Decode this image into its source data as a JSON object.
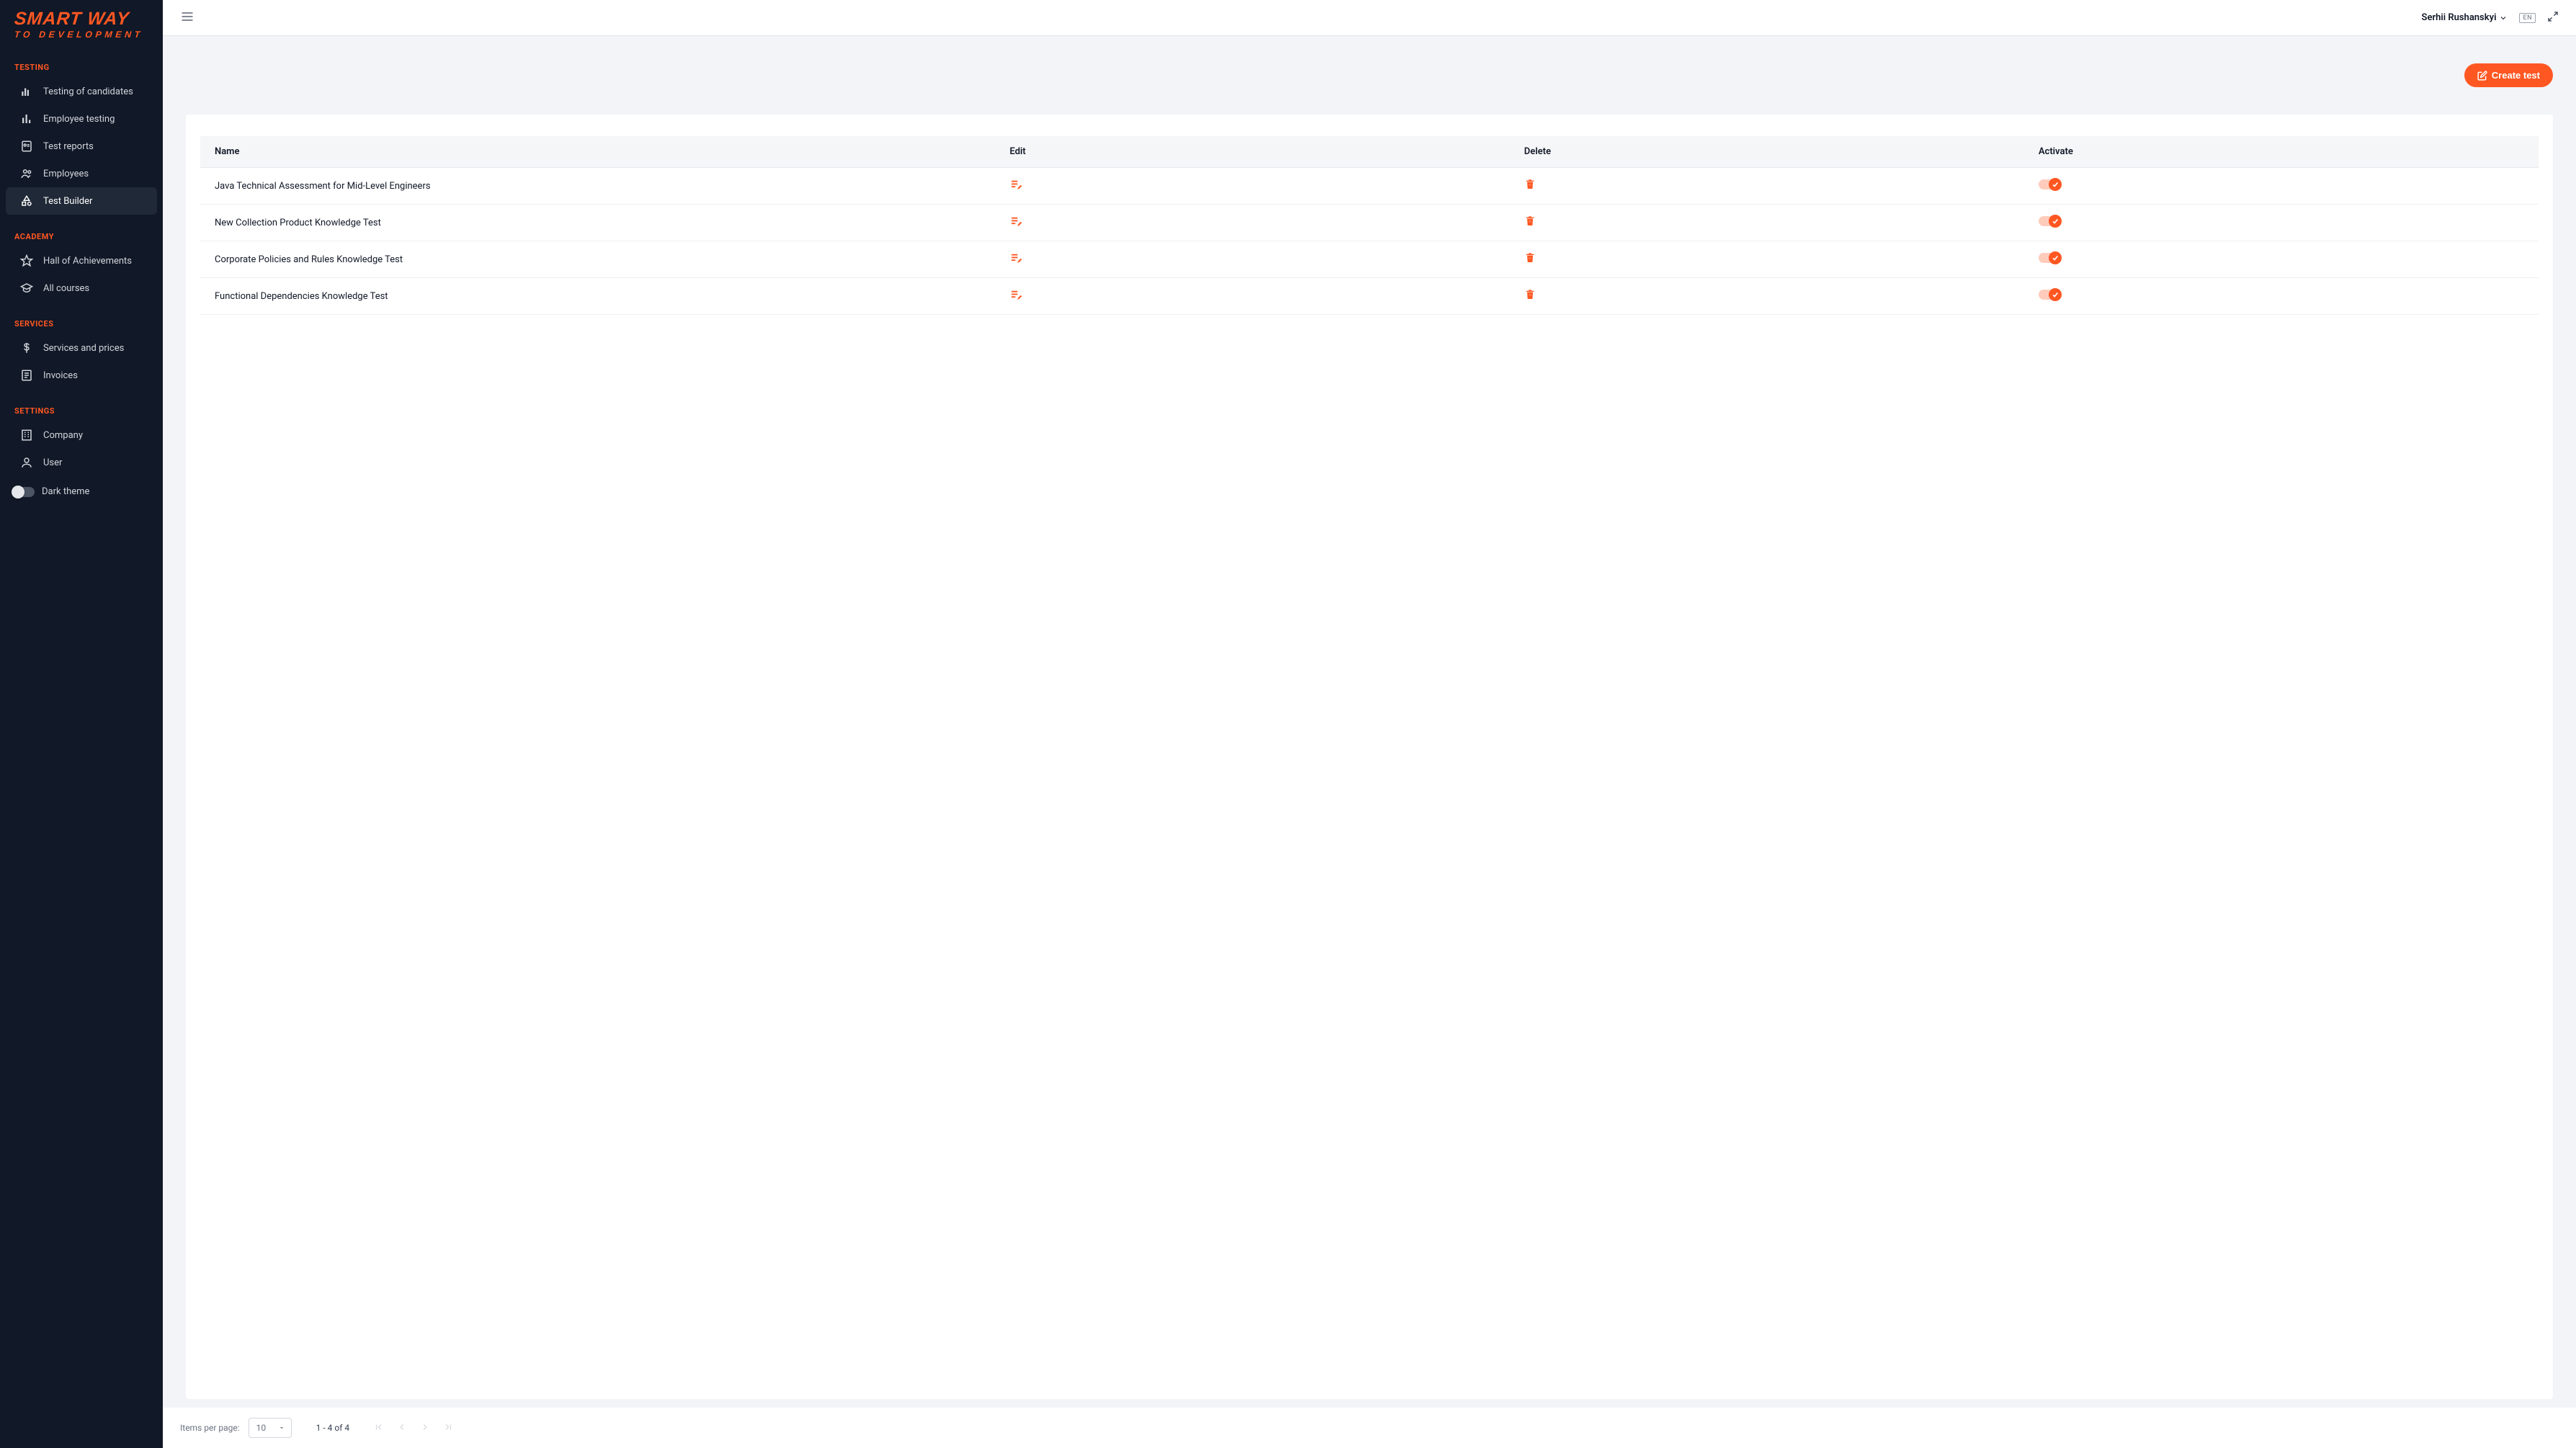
{
  "brand": {
    "line1": "SMART WAY",
    "line2": "TO DEVELOPMENT"
  },
  "sidebar": {
    "sections": [
      {
        "title": "TESTING",
        "items": [
          {
            "label": "Testing of candidates",
            "icon": "bars-icon"
          },
          {
            "label": "Employee testing",
            "icon": "chart-icon"
          },
          {
            "label": "Test reports",
            "icon": "report-icon"
          },
          {
            "label": "Employees",
            "icon": "people-icon"
          },
          {
            "label": "Test Builder",
            "icon": "shapes-icon",
            "active": true
          }
        ]
      },
      {
        "title": "ACADEMY",
        "items": [
          {
            "label": "Hall of Achievements",
            "icon": "star-icon"
          },
          {
            "label": "All courses",
            "icon": "academic-icon"
          }
        ]
      },
      {
        "title": "SERVICES",
        "items": [
          {
            "label": "Services and prices",
            "icon": "dollar-icon"
          },
          {
            "label": "Invoices",
            "icon": "invoice-icon"
          }
        ]
      },
      {
        "title": "SETTINGS",
        "items": [
          {
            "label": "Company",
            "icon": "building-icon"
          },
          {
            "label": "User",
            "icon": "user-icon"
          }
        ]
      }
    ],
    "dark_theme_label": "Dark theme"
  },
  "header": {
    "user_name": "Serhii Rushanskyi",
    "lang": "EN"
  },
  "actions": {
    "create_test": "Create test"
  },
  "table": {
    "columns": {
      "name": "Name",
      "edit": "Edit",
      "delete": "Delete",
      "activate": "Activate"
    },
    "rows": [
      {
        "name": "Java Technical Assessment for Mid-Level Engineers",
        "active": true
      },
      {
        "name": "New Collection Product Knowledge Test",
        "active": true
      },
      {
        "name": "Corporate Policies and Rules Knowledge Test",
        "active": true
      },
      {
        "name": "Functional Dependencies Knowledge Test",
        "active": true
      }
    ]
  },
  "paginator": {
    "items_per_page_label": "Items per page:",
    "page_size": "10",
    "range": "1 - 4 of 4"
  }
}
